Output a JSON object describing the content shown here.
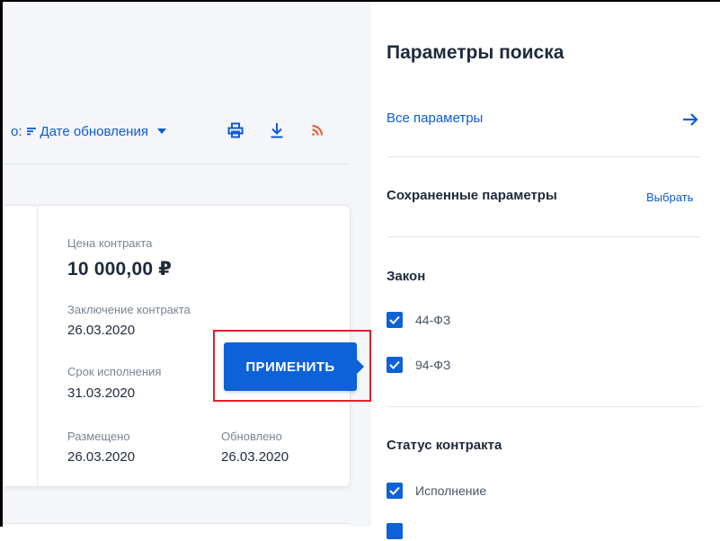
{
  "toolbar": {
    "sort_prefix": "о:",
    "sort_value": "Дате обновления",
    "icons": [
      "sort-icon",
      "caret-down-icon",
      "print-icon",
      "download-icon",
      "rss-icon"
    ]
  },
  "card": {
    "price_label": "Цена контракта",
    "price_value": "10 000,00 ₽",
    "conclusion_label": "Заключение контракта",
    "conclusion_date": "26.03.2020",
    "term_label": "Срок исполнения",
    "term_date": "31.03.2020",
    "placed_label": "Размещено",
    "placed_date": "26.03.2020",
    "updated_label": "Обновлено",
    "updated_date": "26.03.2020"
  },
  "apply": {
    "label": "ПРИМЕНИТЬ",
    "highlight_color": "#e0202a"
  },
  "panel": {
    "title": "Параметры поиска",
    "all_params": "Все параметры",
    "saved_params": "Сохраненные параметры",
    "choose": "Выбрать",
    "law_title": "Закон",
    "laws": [
      {
        "label": "44-ФЗ",
        "checked": true
      },
      {
        "label": "94-ФЗ",
        "checked": true
      }
    ],
    "status_title": "Статус контракта",
    "statuses": [
      {
        "label": "Исполнение",
        "checked": true
      },
      {
        "label": "",
        "checked": true
      }
    ]
  },
  "colors": {
    "accent": "#0e62d8",
    "link": "#0e5bd3",
    "rss": "#f0552a"
  }
}
